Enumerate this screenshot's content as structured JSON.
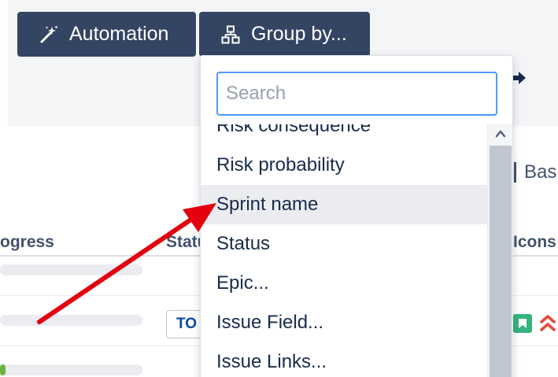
{
  "toolbar": {
    "automation_label": "Automation",
    "automation_icon": "magic-wand-icon",
    "groupby_label": "Group by...",
    "groupby_icon": "hierarchy-icon"
  },
  "board": {
    "label": "Bas"
  },
  "table": {
    "columns": [
      "ogress",
      "Statu",
      "Icons"
    ],
    "rows": [
      {
        "progress": 0,
        "status": ""
      },
      {
        "progress": 0,
        "status": "TO",
        "issue_type_icon": "story-bookmark-icon",
        "priority_icon": "highest-priority-icon"
      },
      {
        "progress": 0.04,
        "status": ""
      }
    ]
  },
  "dropdown": {
    "search_placeholder": "Search",
    "items": [
      "Risk consequence",
      "Risk probability",
      "Sprint name",
      "Status",
      "Epic...",
      "Issue Field...",
      "Issue Links..."
    ],
    "hovered_item": "Sprint name"
  },
  "colors": {
    "toolbar_button": "#344563",
    "search_focus": "#4c9aff",
    "hover_row": "#ebecf0",
    "annotation_arrow": "#e3000f",
    "progress_fill": "#6cb23f"
  }
}
